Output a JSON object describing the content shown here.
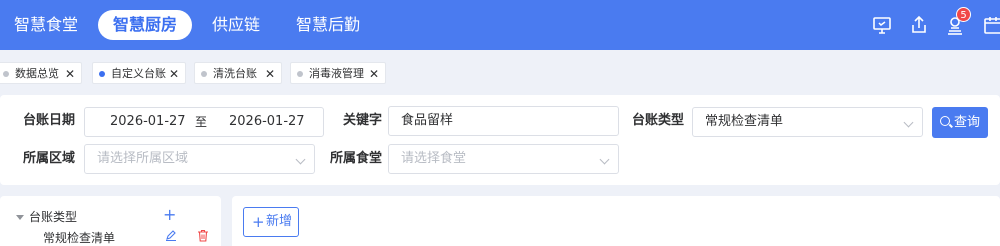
{
  "nav": {
    "items": [
      {
        "label": "智慧食堂",
        "active": false
      },
      {
        "label": "智慧厨房",
        "active": true
      },
      {
        "label": "供应链",
        "active": false
      },
      {
        "label": "智慧后勤",
        "active": false
      }
    ],
    "icons": [
      "monitor-icon",
      "share-icon",
      "notification-icon",
      "calendar-icon"
    ],
    "badge_count": "5",
    "accent_color": "#4a7bf0"
  },
  "tabs": [
    {
      "label": "数据总览",
      "active": false
    },
    {
      "label": "自定义台账",
      "active": true
    },
    {
      "label": "清洗台账",
      "active": false
    },
    {
      "label": "消毒液管理",
      "active": false
    }
  ],
  "filter": {
    "date_label": "台账日期",
    "date_start": "2026-01-27",
    "date_sep": "至",
    "date_end": "2026-01-27",
    "keyword_label": "关键字",
    "keyword_value": "食品留样",
    "type_label": "台账类型",
    "type_value": "常规检查清单",
    "area_label": "所属区域",
    "area_placeholder": "请选择所属区域",
    "canteen_label": "所属食堂",
    "canteen_placeholder": "请选择食堂",
    "query_label": "查询"
  },
  "tree": {
    "root_label": "台账类型",
    "child_label": "常规检查清单"
  },
  "toolbar": {
    "add_label": "新增"
  }
}
